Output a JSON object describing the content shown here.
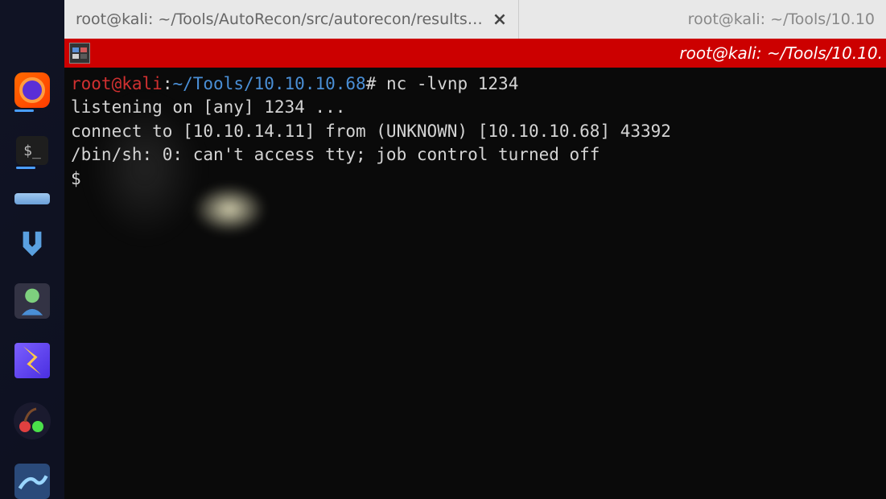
{
  "tabs": [
    {
      "title": "root@kali: ~/Tools/AutoRecon/src/autorecon/results…",
      "closeable": true
    },
    {
      "title": "root@kali: ~/Tools/10.10",
      "closeable": false
    }
  ],
  "window_title": "root@kali: ~/Tools/10.10.",
  "terminal": {
    "prompt": {
      "user": "root",
      "at": "@",
      "host": "kali",
      "colon": ":",
      "path": "~/Tools/10.10.10.68",
      "hash": "#"
    },
    "command": " nc -lvnp 1234",
    "lines": [
      "listening on [any] 1234 ...",
      "connect to [10.10.14.11] from (UNKNOWN) [10.10.10.68] 43392",
      "/bin/sh: 0: can't access tty; job control turned off"
    ],
    "shell_prompt": "$ "
  },
  "dock": {
    "firefox": "firefox",
    "terminal_glyph": "$_",
    "files": "files",
    "metasploit": "metasploit",
    "maltego": "maltego",
    "burp": "burp",
    "cherrytree": "cherrytree",
    "wireshark": "wireshark"
  },
  "colors": {
    "titlebar_bg": "#cc0000",
    "prompt_user": "#d03030",
    "prompt_path": "#4a8fd6"
  }
}
